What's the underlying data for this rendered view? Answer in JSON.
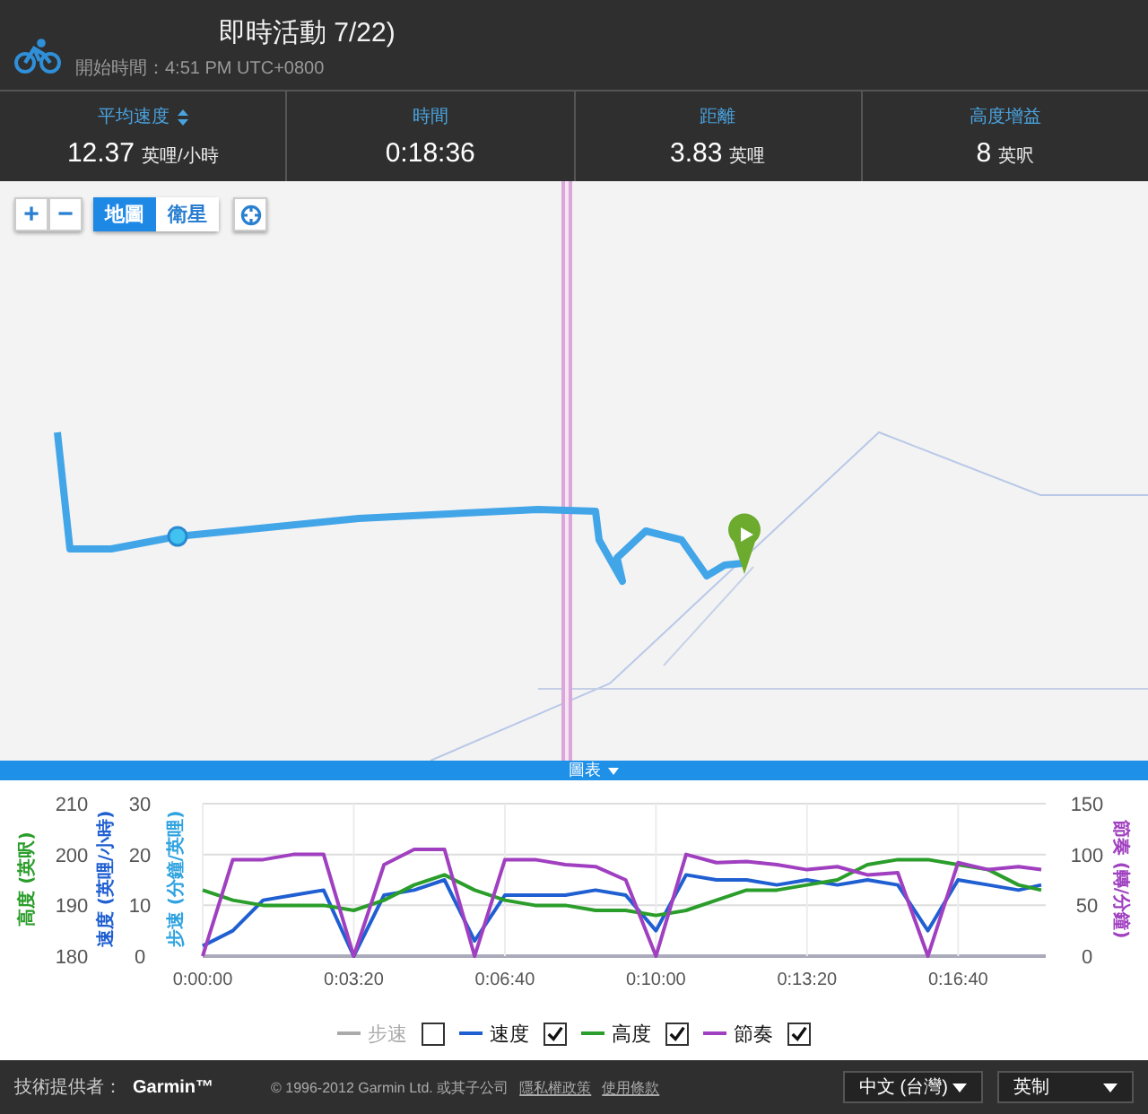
{
  "header": {
    "title": "即時活動 7/22)",
    "start_time": "開始時間：4:51 PM UTC+0800"
  },
  "stats": [
    {
      "label": "平均速度",
      "value": "12.37",
      "unit": "英哩/小時",
      "sortable": true
    },
    {
      "label": "時間",
      "value": "0:18:36",
      "sortable": false
    },
    {
      "label": "距離",
      "value": "3.83",
      "unit": "英哩",
      "sortable": false
    },
    {
      "label": "高度增益",
      "value": "8",
      "unit": "英呎",
      "sortable": false
    }
  ],
  "map": {
    "zoom_in": "+",
    "zoom_out": "−",
    "tabs": [
      {
        "label": "地圖",
        "selected": true
      },
      {
        "label": "衛星",
        "selected": false
      }
    ]
  },
  "chart_toggle": {
    "label": "圖表",
    "expanded": true
  },
  "chart": {
    "chart_data": {
      "type": "line",
      "x": [
        0,
        40,
        80,
        120,
        160,
        200,
        240,
        280,
        320,
        360,
        400,
        440,
        480,
        520,
        560,
        600,
        640,
        680,
        720,
        760,
        800,
        840,
        880,
        920,
        960,
        1000,
        1040,
        1080,
        1110
      ],
      "xlim": [
        0,
        1116
      ],
      "grid": true,
      "xticks": [
        {
          "value": 0,
          "label": "0:00:00"
        },
        {
          "value": 200,
          "label": "0:03:20"
        },
        {
          "value": 400,
          "label": "0:06:40"
        },
        {
          "value": 600,
          "label": "0:10:00"
        },
        {
          "value": 800,
          "label": "0:13:20"
        },
        {
          "value": 1000,
          "label": "0:16:40"
        }
      ],
      "ylabel": "速度 (英哩/小時)",
      "ylim": [
        0,
        30
      ],
      "yticks": [
        0,
        10,
        20,
        30
      ],
      "y2label": "高度 (英呎)",
      "y2lim": [
        180,
        210
      ],
      "y2ticks": [
        180,
        190,
        200,
        210
      ],
      "y3label": "節奏 (轉/分鐘)",
      "y3lim": [
        0,
        150
      ],
      "y3ticks": [
        0,
        50,
        100,
        150
      ],
      "series": [
        {
          "name": "步速",
          "color": "#aaaaaa",
          "values": [
            null,
            null,
            null,
            null,
            null,
            null,
            null,
            null,
            null,
            null,
            null,
            null,
            null,
            null,
            null,
            null,
            null,
            null,
            null,
            null,
            null,
            null,
            null,
            null,
            null,
            null,
            null,
            null,
            null
          ]
        },
        {
          "name": "速度",
          "color": "#1f5fd1",
          "values": [
            2,
            5,
            11,
            12,
            13,
            0,
            12,
            13,
            15,
            3,
            12,
            12,
            12,
            13,
            12,
            5,
            16,
            15,
            15,
            14,
            15,
            14,
            15,
            14,
            5,
            15,
            14,
            13,
            14
          ]
        },
        {
          "name": "高度",
          "color": "#2a9d2a",
          "axis": "y2",
          "values": [
            193,
            191,
            190,
            190,
            190,
            189,
            191,
            194,
            196,
            193,
            191,
            190,
            190,
            189,
            189,
            188,
            189,
            191,
            193,
            193,
            194,
            195,
            198,
            199,
            199,
            198,
            197,
            194,
            193
          ]
        },
        {
          "name": "節奏",
          "color": "#a040c0",
          "axis": "y3",
          "values": [
            0,
            95,
            95,
            100,
            100,
            0,
            90,
            105,
            105,
            0,
            95,
            95,
            90,
            88,
            75,
            0,
            100,
            92,
            93,
            90,
            85,
            88,
            80,
            82,
            0,
            92,
            85,
            88,
            85
          ]
        }
      ]
    },
    "pace_axis_title": "步速 (分鐘/英哩)",
    "legend": [
      {
        "checked": false,
        "disabled": true
      },
      {
        "checked": true,
        "disabled": false
      },
      {
        "checked": true,
        "disabled": false
      },
      {
        "checked": true,
        "disabled": false
      }
    ]
  },
  "footer": {
    "provider_label": "技術提供者：",
    "provider": "Garmin™",
    "copyright": "© 1996-2012 Garmin Ltd. 或其子公司",
    "links": [
      "隱私權政策",
      "使用條款"
    ],
    "language": "中文 (台灣)",
    "units": "英制"
  }
}
